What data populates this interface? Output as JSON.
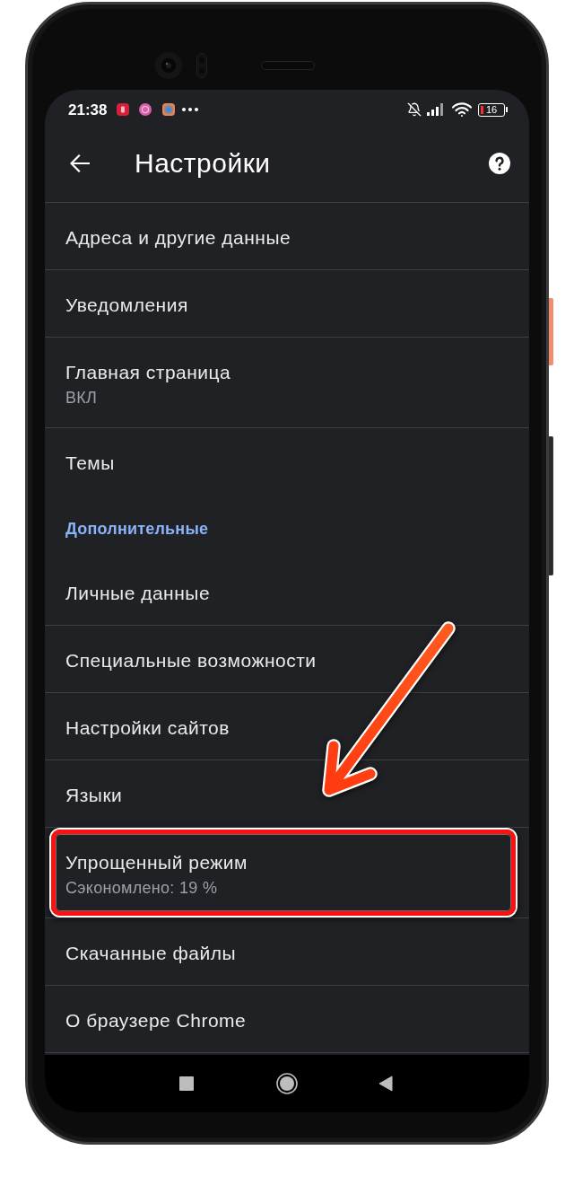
{
  "status_bar": {
    "time": "21:38",
    "battery": "16"
  },
  "toolbar": {
    "title": "Настройки"
  },
  "sections": [
    {
      "items": [
        {
          "title": "Адреса и другие данные",
          "highlighted": false
        },
        {
          "title": "Уведомления",
          "highlighted": false
        },
        {
          "title": "Главная страница",
          "subtitle": "ВКЛ",
          "highlighted": false
        },
        {
          "title": "Темы",
          "highlighted": false
        }
      ]
    },
    {
      "header": "Дополнительные",
      "items": [
        {
          "title": "Личные данные",
          "highlighted": false
        },
        {
          "title": "Специальные возможности",
          "highlighted": false
        },
        {
          "title": "Настройки сайтов",
          "highlighted": false
        },
        {
          "title": "Языки",
          "highlighted": false
        },
        {
          "title": "Упрощенный режим",
          "subtitle": "Сэкономлено: 19 %",
          "highlighted": true
        },
        {
          "title": "Скачанные файлы",
          "highlighted": false
        },
        {
          "title": "О браузере Chrome",
          "highlighted": false
        }
      ]
    }
  ],
  "annotations": {
    "arrow": true
  }
}
